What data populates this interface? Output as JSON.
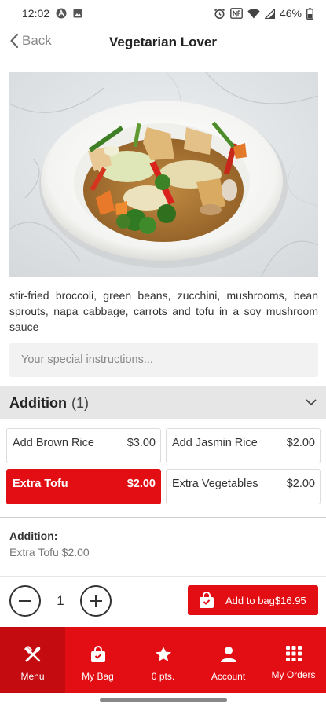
{
  "status_bar": {
    "time": "12:02",
    "battery": "46%"
  },
  "header": {
    "back_label": "Back",
    "title": "Vegetarian Lover"
  },
  "item": {
    "description": "stir-fried broccoli, green beans, zucchini, mushrooms, bean sprouts, napa cabbage, carrots and tofu in a soy mushroom sauce",
    "instructions_placeholder": "Your special instructions..."
  },
  "addition_section": {
    "title": "Addition",
    "count": "(1)",
    "options": [
      {
        "name": "Add Brown Rice",
        "price": "$3.00",
        "selected": false
      },
      {
        "name": "Add Jasmin Rice",
        "price": "$2.00",
        "selected": false
      },
      {
        "name": "Extra Tofu",
        "price": "$2.00",
        "selected": true
      },
      {
        "name": "Extra Vegetables",
        "price": "$2.00",
        "selected": false
      }
    ]
  },
  "summary": {
    "label": "Addition:",
    "value": "Extra Tofu $2.00"
  },
  "order": {
    "quantity": "1",
    "add_to_bag_label": "Add to bag$16.95"
  },
  "tabbar": {
    "items": [
      {
        "label": "Menu",
        "icon": "fork-knife-icon",
        "active": true
      },
      {
        "label": "My Bag",
        "icon": "bag-icon",
        "active": false
      },
      {
        "label": "0 pts.",
        "icon": "star-icon",
        "active": false
      },
      {
        "label": "Account",
        "icon": "person-icon",
        "active": false
      },
      {
        "label": "My Orders",
        "icon": "grid-icon",
        "active": false
      }
    ]
  },
  "colors": {
    "accent": "#e20e13",
    "accent_dark": "#c40b10",
    "section_bg": "#e6e6e6"
  }
}
